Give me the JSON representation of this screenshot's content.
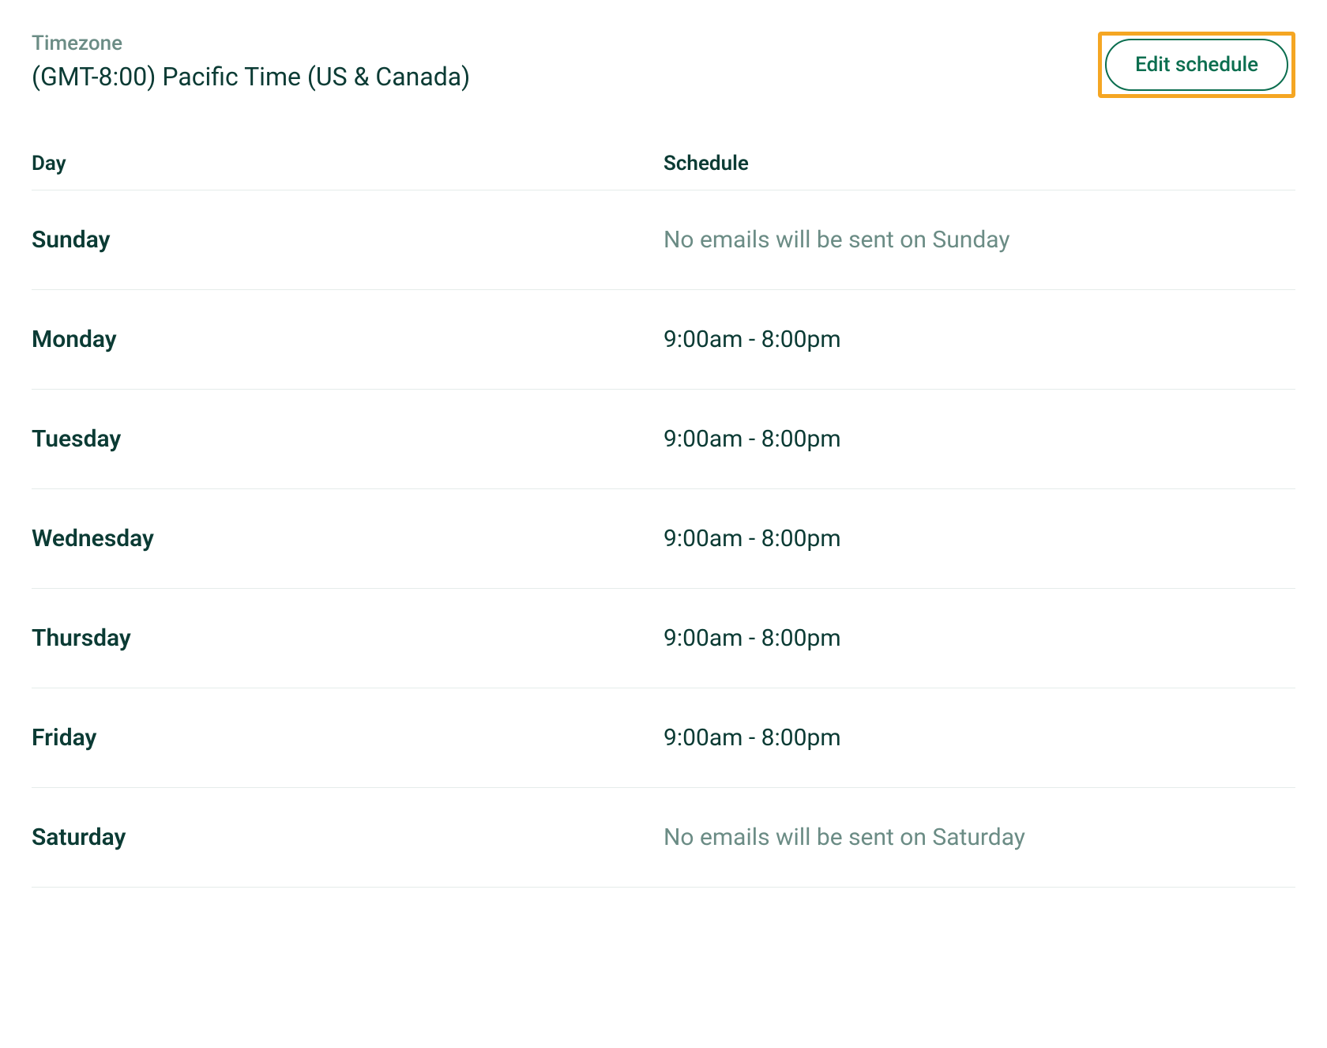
{
  "header": {
    "timezone_label": "Timezone",
    "timezone_value": "(GMT-8:00) Pacific Time (US & Canada)",
    "edit_button_label": "Edit schedule"
  },
  "table": {
    "columns": {
      "day": "Day",
      "schedule": "Schedule"
    },
    "rows": [
      {
        "day": "Sunday",
        "schedule": "No emails will be sent on Sunday",
        "active": false
      },
      {
        "day": "Monday",
        "schedule": "9:00am - 8:00pm",
        "active": true
      },
      {
        "day": "Tuesday",
        "schedule": "9:00am - 8:00pm",
        "active": true
      },
      {
        "day": "Wednesday",
        "schedule": "9:00am - 8:00pm",
        "active": true
      },
      {
        "day": "Thursday",
        "schedule": "9:00am - 8:00pm",
        "active": true
      },
      {
        "day": "Friday",
        "schedule": "9:00am - 8:00pm",
        "active": true
      },
      {
        "day": "Saturday",
        "schedule": "No emails will be sent on Saturday",
        "active": false
      }
    ]
  },
  "colors": {
    "text_primary": "#0b3b34",
    "text_muted": "#6b8c85",
    "accent_green": "#0b6e4f",
    "highlight_orange": "#f5a623",
    "divider": "#e5ecea"
  }
}
